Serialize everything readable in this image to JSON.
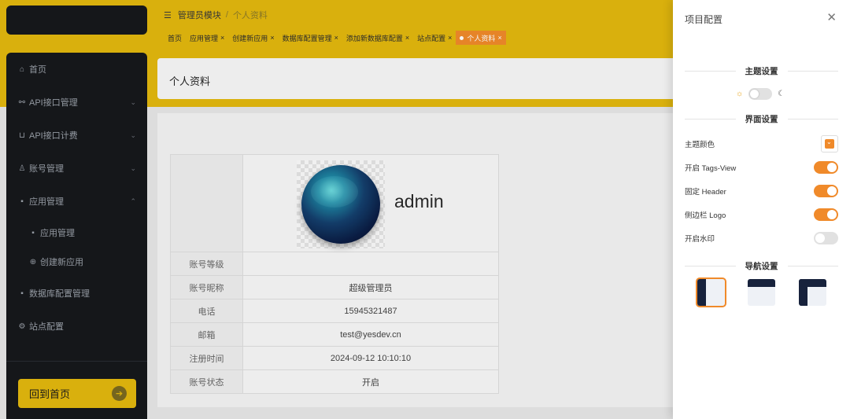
{
  "sidebar": {
    "items": [
      {
        "label": "首页",
        "icon": "home-icon",
        "glyph": "⌂",
        "arrow": ""
      },
      {
        "label": "API接口管理",
        "icon": "link-icon",
        "glyph": "⚯",
        "arrow": "⌄"
      },
      {
        "label": "API接口计费",
        "icon": "cart-icon",
        "glyph": "⊔",
        "arrow": "⌄"
      },
      {
        "label": "账号管理",
        "icon": "user-icon",
        "glyph": "♙",
        "arrow": "⌄"
      },
      {
        "label": "应用管理",
        "icon": "grid-icon",
        "glyph": "▪",
        "arrow": "⌃"
      },
      {
        "label": "应用管理",
        "icon": "app-icon",
        "glyph": "▪",
        "arrow": ""
      },
      {
        "label": "创建新应用",
        "icon": "plus-circle-icon",
        "glyph": "⊕",
        "arrow": ""
      },
      {
        "label": "数据库配置管理",
        "icon": "database-icon",
        "glyph": "▪",
        "arrow": ""
      },
      {
        "label": "站点配置",
        "icon": "settings-icon",
        "glyph": "⚙",
        "arrow": ""
      }
    ],
    "home_button": "回到首页",
    "home_button_arrow": "➔"
  },
  "header": {
    "breadcrumb": [
      "管理员模块",
      "个人资料"
    ],
    "breadcrumb_sep": "/",
    "tags": [
      {
        "label": "首页",
        "closable": false,
        "active": false
      },
      {
        "label": "应用管理",
        "closable": true,
        "active": false
      },
      {
        "label": "创建新应用",
        "closable": true,
        "active": false
      },
      {
        "label": "数据库配置管理",
        "closable": true,
        "active": false
      },
      {
        "label": "添加新数据库配置",
        "closable": true,
        "active": false
      },
      {
        "label": "站点配置",
        "closable": true,
        "active": false
      },
      {
        "label": "个人资料",
        "closable": true,
        "active": true
      }
    ],
    "tag_close": "×"
  },
  "page": {
    "title": "个人资料",
    "username": "admin",
    "fields": [
      {
        "key": "账号等级",
        "value": ""
      },
      {
        "key": "账号昵称",
        "value": "超级管理员"
      },
      {
        "key": "电话",
        "value": "15945321487"
      },
      {
        "key": "邮箱",
        "value": "test@yesdev.cn"
      },
      {
        "key": "注册时间",
        "value": "2024-09-12 10:10:10"
      },
      {
        "key": "账号状态",
        "value": "开启"
      }
    ]
  },
  "drawer": {
    "title": "项目配置",
    "close": "✕",
    "theme_section": "主题设置",
    "theme_sun": "☼",
    "theme_moon": "☾",
    "ui_section": "界面设置",
    "settings": [
      {
        "label": "主题颜色",
        "type": "color",
        "value": "#f08a2a"
      },
      {
        "label": "开启 Tags-View",
        "type": "switch",
        "on": true
      },
      {
        "label": "固定 Header",
        "type": "switch",
        "on": true
      },
      {
        "label": "侧边栏 Logo",
        "type": "switch",
        "on": true
      },
      {
        "label": "开启水印",
        "type": "switch",
        "on": false
      }
    ],
    "nav_section": "导航设置",
    "nav_layouts": [
      "left-sidebar",
      "top-bar",
      "mixed"
    ],
    "selected_layout": "left-sidebar"
  },
  "colors": {
    "accent": "#f08a2a",
    "header_yellow": "#e2b80e",
    "sidebar_bg": "#16181c",
    "nav_dark": "#17223c"
  }
}
